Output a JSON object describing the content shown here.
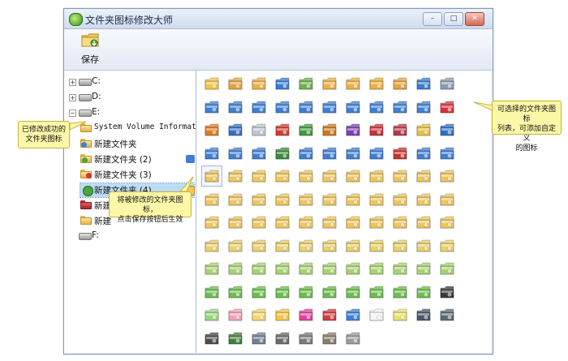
{
  "window": {
    "title": "文件夹图标修改大师",
    "min_symbol": "–",
    "max_symbol": "□",
    "close_symbol": "✕"
  },
  "toolbar": {
    "save_label": "保存"
  },
  "tree": {
    "drives": [
      "C:",
      "D:",
      "E:",
      "F:"
    ],
    "expand_plus": "+",
    "expand_minus": "−",
    "items": [
      "System Volume Informat:",
      "新建文件夹",
      "新建文件夹 (2)",
      "新建文件夹 (3)",
      "新建文件夹 (4)",
      "新建文件夹 (5)",
      "新建"
    ]
  },
  "callouts": {
    "left": [
      "已修改成功的",
      "文件夹图标"
    ],
    "center": [
      "将被修改的文件夹图标，",
      "点击保存按钮后生效"
    ],
    "right": [
      "可选择的文件夹图标",
      "列表，可添加自定义",
      "的图标"
    ]
  },
  "icon_colors": [
    [
      "#f5c542",
      "#e8a33a",
      "#f0b13e",
      "#3a7bd5",
      "#6ab04c",
      "#f0b13e",
      "#f0b13e",
      "#f0b13e",
      "#e8a33a",
      "#3a7bd5",
      "#8a9ab5"
    ],
    [
      "#3d7fd6",
      "#3d7fd6",
      "#3d7fd6",
      "#3d7fd6",
      "#3d7fd6",
      "#3d7fd6",
      "#3d7fd6",
      "#3d7fd6",
      "#3d7fd6",
      "#3d7fd6",
      "#d9303a"
    ],
    [
      "#e07b1c",
      "#2f6fc4",
      "#c0c7d1",
      "#d23c2c",
      "#3f9b3a",
      "#cc7a1a",
      "#7c3fb2",
      "#c92f3a",
      "#b53a45",
      "#e9c23b",
      "#2f6fc4"
    ],
    [
      "#3d7fd6",
      "#3d7fd6",
      "#3d7fd6",
      "#3b8a3b",
      "#3d7fd6",
      "#3d7fd6",
      "#3d7fd6",
      "#3d7fd6",
      "#c9302c",
      "#3d7fd6",
      "#3d7fd6"
    ],
    [
      "#f0c65a",
      "#f0c65a",
      "#f0c65a",
      "#f0c65a",
      "#f0c65a",
      "#f0c65a",
      "#f0c65a",
      "#f0c65a",
      "#f0c65a",
      "#f0c65a",
      "#f0c65a"
    ],
    [
      "#f0c65a",
      "#f0c65a",
      "#f0c65a",
      "#f0c65a",
      "#f0c65a",
      "#f0c65a",
      "#f0c65a",
      "#f0c65a",
      "#f0c65a",
      "#f0c65a",
      "#f0c65a"
    ],
    [
      "#f0c65a",
      "#f0c65a",
      "#f0c65a",
      "#f0c65a",
      "#f0c65a",
      "#f0c65a",
      "#f0c65a",
      "#f0c65a",
      "#f0c65a",
      "#f0c65a",
      "#f0c65a"
    ],
    [
      "#e9d06a",
      "#e9d06a",
      "#e9d06a",
      "#e9d06a",
      "#e9d06a",
      "#e9d06a",
      "#e9d06a",
      "#e9d06a",
      "#e9d06a",
      "#e9d06a",
      "#e9d06a"
    ],
    [
      "#a8d46f",
      "#a8d46f",
      "#a8d46f",
      "#a8d46f",
      "#a8d46f",
      "#a8d46f",
      "#a8d46f",
      "#a8d46f",
      "#a8d46f",
      "#a8d46f",
      "#a8d46f"
    ],
    [
      "#6abf4b",
      "#6abf4b",
      "#6abf4b",
      "#6abf4b",
      "#6abf4b",
      "#6abf4b",
      "#6abf4b",
      "#6abf4b",
      "#6abf4b",
      "#6abf4b",
      "#3a3a3a"
    ],
    [
      "#9bd77a",
      "#f3a0b4",
      "#f5d86a",
      "#f5c542",
      "#e83e9c",
      "#d6393c",
      "#3d7fd6",
      "#f5f5f5",
      "#e9e36a",
      "#4a5868",
      "#5a6a74"
    ],
    [
      "#4b4b4b",
      "#3f7f3a",
      "#6f7f8f",
      "#6a6a6a",
      "#7a7a7a",
      "#8a7a6a",
      "#9a9a9a"
    ]
  ]
}
